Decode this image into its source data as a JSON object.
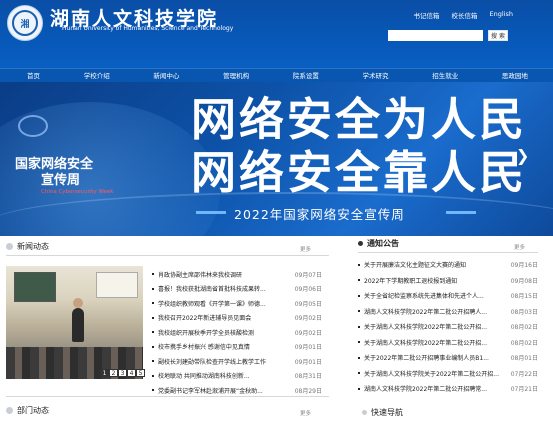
{
  "header": {
    "title_cn": "湖南人文科技学院",
    "title_en": "Hunan University of Humanities, Science and Technology",
    "logo_text": "湘",
    "links": [
      "书记信箱",
      "校长信箱",
      "English"
    ],
    "search_placeholder": "",
    "search_button": "搜 索"
  },
  "nav": {
    "items": [
      "首页",
      "学校介绍",
      "新闻中心",
      "管理机构",
      "院系设置",
      "学术研究",
      "招生就业",
      "思政园地"
    ]
  },
  "banner": {
    "headline_line1": "网络安全为人民",
    "headline_line2": "网络安全靠人民",
    "subtitle": "2022年国家网络安全宣传周",
    "left_cn_line1": "国家网络安全",
    "left_cn_line2": "宣传周",
    "left_en": "China Cybersecurity Week",
    "next_arrow": "❯"
  },
  "news": {
    "title": "新闻动态",
    "more": "更多",
    "pager": [
      "1",
      "2",
      "3",
      "4",
      "5"
    ],
    "active_page": "1",
    "items": [
      {
        "title": "肖政协副主席邵伟林来我校调研",
        "date": "09月07日"
      },
      {
        "title": "喜报！我校获批湖南省首批科技成果转...",
        "date": "09月06日"
      },
      {
        "title": "学校组织教师观看《开学第一课》师德...",
        "date": "09月05日"
      },
      {
        "title": "我校召开2022年新进辅导员见面会",
        "date": "09月02日"
      },
      {
        "title": "我校组织开展秋季开学全员核酸检测",
        "date": "09月02日"
      },
      {
        "title": "校市携手乡村振兴 感谢信中见真情",
        "date": "09月01日"
      },
      {
        "title": "副校长刘建勋带队检查开学线上教学工作",
        "date": "09月01日"
      },
      {
        "title": "校地联动 共同推动湖南科技创新...",
        "date": "08月31日"
      },
      {
        "title": "党委副书记李军林赴溆浦开展“金秋助...",
        "date": "08月29日"
      }
    ]
  },
  "notice": {
    "title": "通知公告",
    "more": "更多",
    "items": [
      {
        "title": "关于开展廉洁文化主题征文大赛的通知",
        "date": "09月16日"
      },
      {
        "title": "2022年下学期教职工退校报到通知",
        "date": "09月08日"
      },
      {
        "title": "关于全省纪检监察系统先进集体和先进个人...",
        "date": "08月15日"
      },
      {
        "title": "湖南人文科技学院2022年第二批公开招聘人...",
        "date": "08月03日"
      },
      {
        "title": "关于湖南人文科技学院2022年第二批公开招...",
        "date": "08月02日"
      },
      {
        "title": "关于湖南人文科技学院2022年第二批公开招...",
        "date": "08月02日"
      },
      {
        "title": "关于2022年第二批公开招聘事业编制人员B1...",
        "date": "08月01日"
      },
      {
        "title": "关于湖南人文科技学院关于2022年第二批公开招...",
        "date": "07月22日"
      },
      {
        "title": "湖南人文科技学院2022年第二批公开招聘常...",
        "date": "07月21日"
      }
    ]
  },
  "dept": {
    "title": "部门动态",
    "more": "更多"
  },
  "quicknav": {
    "title": "快速导航"
  },
  "colors": {
    "brand_blue": "#0758b8",
    "nav_blue": "#0956b0",
    "banner_blue": "#0d52a8"
  }
}
